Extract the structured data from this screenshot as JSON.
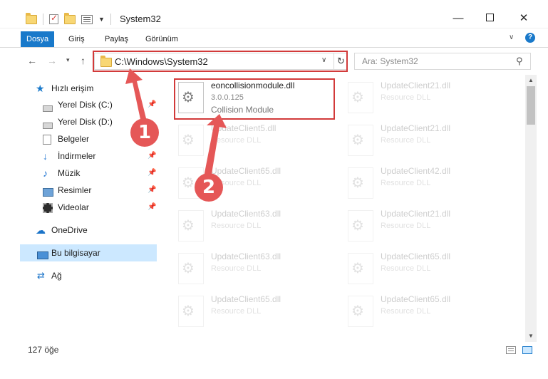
{
  "window": {
    "title": "System32",
    "minimize_glyph": "—",
    "close_glyph": "✕"
  },
  "ribbon": {
    "tabs": [
      "Dosya",
      "Giriş",
      "Paylaş",
      "Görünüm"
    ],
    "active_tab": "Dosya",
    "help_glyph": "?"
  },
  "address": {
    "path": "C:\\Windows\\System32",
    "search_placeholder": "Ara: System32"
  },
  "sidebar": {
    "items": [
      {
        "label": "Hızlı erişim",
        "icon": "star-icon",
        "pinned": false
      },
      {
        "label": "Yerel Disk (C:)",
        "icon": "drive-icon",
        "pinned": true
      },
      {
        "label": "Yerel Disk (D:)",
        "icon": "drive-icon",
        "pinned": false
      },
      {
        "label": "Belgeler",
        "icon": "documents-icon",
        "pinned": true
      },
      {
        "label": "İndirmeler",
        "icon": "download-icon",
        "pinned": true
      },
      {
        "label": "Müzik",
        "icon": "music-icon",
        "pinned": true
      },
      {
        "label": "Resimler",
        "icon": "pictures-icon",
        "pinned": true
      },
      {
        "label": "Videolar",
        "icon": "videos-icon",
        "pinned": true
      },
      {
        "label": "OneDrive",
        "icon": "cloud-icon",
        "pinned": false
      },
      {
        "label": "Bu bilgisayar",
        "icon": "computer-icon",
        "pinned": false,
        "selected": true
      },
      {
        "label": "Ağ",
        "icon": "network-icon",
        "pinned": false
      }
    ]
  },
  "files": {
    "highlighted": {
      "name": "eoncollisionmodule.dll",
      "version": "3.0.0.125",
      "description": "Collision Module"
    },
    "background": [
      {
        "name": "UpdateClient21.dll",
        "description": "Resource DLL"
      },
      {
        "name": "UpdateClient5.dll",
        "description": "Resource DLL"
      },
      {
        "name": "UpdateClient21.dll",
        "description": "Resource DLL"
      },
      {
        "name": "UpdateClient65.dll",
        "description": "Resource DLL"
      },
      {
        "name": "UpdateClient42.dll",
        "description": "Resource DLL"
      },
      {
        "name": "UpdateClient63.dll",
        "description": "Resource DLL"
      },
      {
        "name": "UpdateClient21.dll",
        "description": "Resource DLL"
      },
      {
        "name": "UpdateClient63.dll",
        "description": "Resource DLL"
      },
      {
        "name": "UpdateClient65.dll",
        "description": "Resource DLL"
      },
      {
        "name": "UpdateClient65.dll",
        "description": "Resource DLL"
      },
      {
        "name": "UpdateClient65.dll",
        "description": "Resource DLL"
      }
    ]
  },
  "status": {
    "item_count": "127 öğe"
  },
  "annotations": {
    "step1": "1",
    "step2": "2",
    "color": "#e55757"
  }
}
